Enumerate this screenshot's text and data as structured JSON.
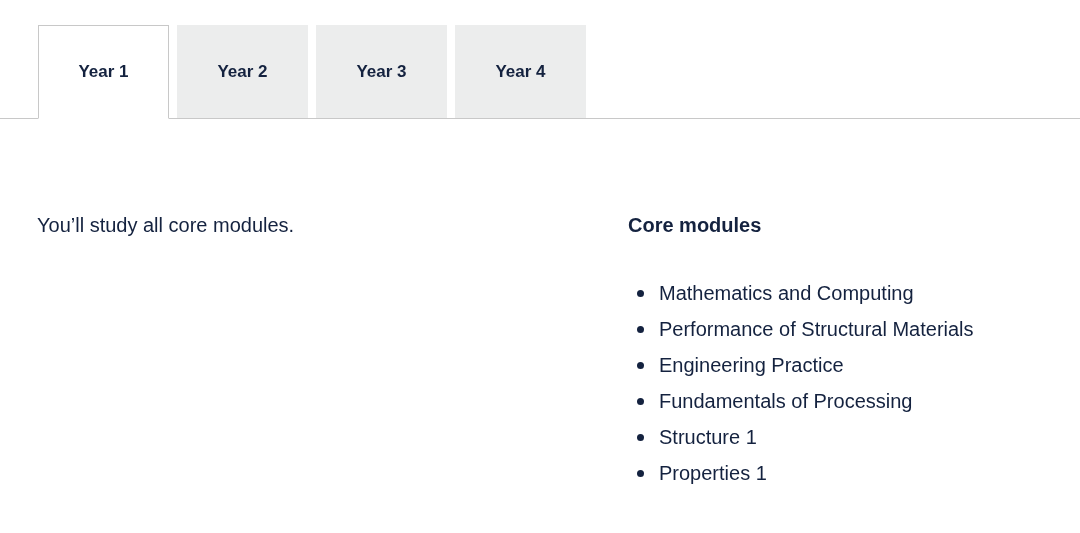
{
  "tabs": [
    {
      "label": "Year 1",
      "selected": true
    },
    {
      "label": "Year 2",
      "selected": false
    },
    {
      "label": "Year 3",
      "selected": false
    },
    {
      "label": "Year 4",
      "selected": false
    }
  ],
  "intro": "You’ll study all core modules.",
  "core_modules": {
    "heading": "Core modules",
    "items": [
      "Mathematics and Computing",
      "Performance of Structural Materials",
      "Engineering Practice",
      "Fundamentals of Processing",
      "Structure 1",
      "Properties 1"
    ]
  }
}
